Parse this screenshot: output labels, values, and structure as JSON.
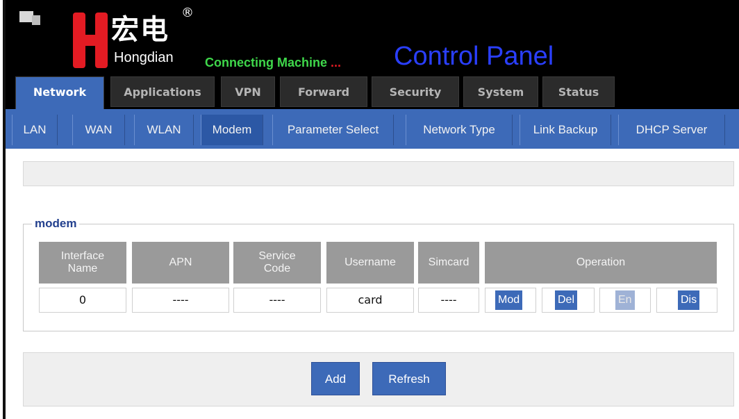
{
  "header": {
    "brand_cn": "宏电",
    "brand_reg": "®",
    "brand_en": "Hongdian",
    "tagline": "Connecting Machine",
    "tagline_dots": " ...",
    "title": "Control Panel"
  },
  "main_tabs": [
    {
      "label": "Network",
      "active": true
    },
    {
      "label": "Applications"
    },
    {
      "label": "VPN"
    },
    {
      "label": "Forward"
    },
    {
      "label": "Security"
    },
    {
      "label": "System"
    },
    {
      "label": "Status"
    }
  ],
  "sub_tabs": [
    {
      "label": "LAN"
    },
    {
      "label": "WAN"
    },
    {
      "label": "WLAN"
    },
    {
      "label": "Modem",
      "active": true
    },
    {
      "label": "Parameter Select"
    },
    {
      "label": "Network Type"
    },
    {
      "label": "Link Backup"
    },
    {
      "label": "DHCP Server"
    }
  ],
  "modem": {
    "legend": "modem",
    "columns": [
      "Interface\nName",
      "APN",
      "Service\nCode",
      "Username",
      "Simcard",
      "Operation"
    ],
    "rows": [
      {
        "interface": "0",
        "apn": "----",
        "service_code": "----",
        "username": "card",
        "simcard": "----",
        "ops": {
          "mod": "Mod",
          "del": "Del",
          "en": "En",
          "dis": "Dis"
        }
      }
    ]
  },
  "actions": {
    "add": "Add",
    "refresh": "Refresh"
  },
  "colors": {
    "accent": "#3d6ab8",
    "title": "#2a3fff",
    "tagline": "#3fd84b",
    "brand_red": "#e31b23"
  },
  "icons": [
    "logo-mark-icon",
    "hongdian-h-logo-icon"
  ]
}
